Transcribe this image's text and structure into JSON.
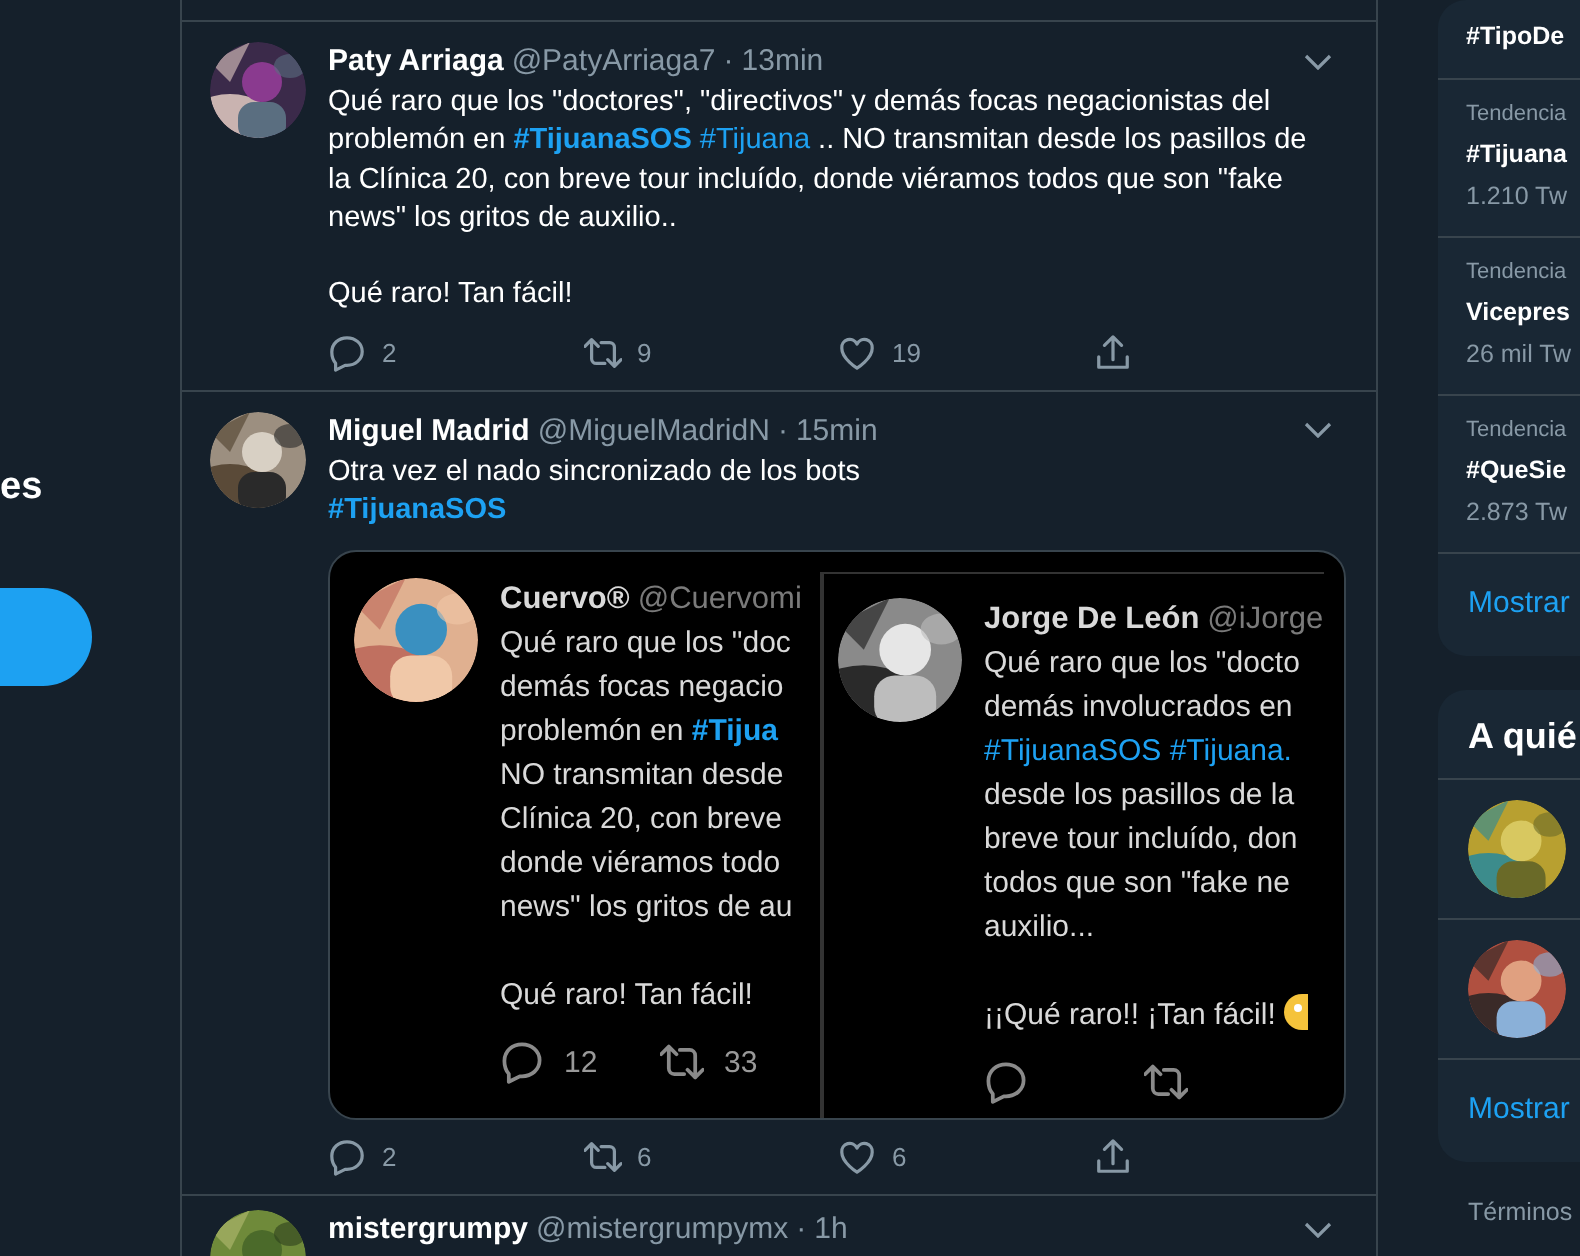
{
  "left_nav": {
    "item_text": "es"
  },
  "tweets": [
    {
      "name": "Paty Arriaga",
      "handle": "@PatyArriaga7",
      "separator": "·",
      "time": "13min",
      "avatar": {
        "kind": "picture"
      },
      "body": [
        {
          "kind": "text",
          "text": "Qué raro que los \"doctores\", \"directivos\" y demás focas negacionistas del problemón en "
        },
        {
          "kind": "hashtag",
          "bold": true,
          "text": "#TijuanaSOS "
        },
        {
          "kind": "hashtag",
          "bold": false,
          "text": "#Tijuana"
        },
        {
          "kind": "text",
          "text": " .. NO transmitan desde los pasillos de la Clínica 20, con breve tour incluído, donde viéramos todos que son \"fake news\" los gritos de auxilio..\n\nQué raro! Tan fácil!"
        }
      ],
      "actions": [
        {
          "kind": "reply",
          "count": "2"
        },
        {
          "kind": "retweet",
          "count": "9"
        },
        {
          "kind": "like",
          "count": "19"
        },
        {
          "kind": "share"
        }
      ]
    },
    {
      "name": "Miguel Madrid",
      "handle": "@MiguelMadridN",
      "separator": "·",
      "time": "15min",
      "avatar": {
        "kind": "picture"
      },
      "body": [
        {
          "kind": "text",
          "text": "Otra vez el nado sincronizado de los bots\n"
        },
        {
          "kind": "hashtag",
          "bold": true,
          "text": "#TijuanaSOS"
        }
      ],
      "media": {
        "panels": [
          {
            "name": "Cuervo®",
            "handle": "@Cuervomi",
            "avatar": {
              "kind": "picture"
            },
            "body": [
              {
                "kind": "text",
                "text": "Qué raro que los \"doc\ndemás focas negacio\nproblemón en "
              },
              {
                "kind": "hashtag",
                "bold": true,
                "text": "#Tijua"
              },
              {
                "kind": "text",
                "text": "\nNO transmitan desde\nClínica 20, con breve\ndonde viéramos todo\nnews\" los gritos de au\n\nQué raro! Tan fácil!"
              }
            ],
            "emoji": false,
            "actions": [
              {
                "kind": "reply",
                "count": "12"
              },
              {
                "kind": "retweet",
                "count": "33"
              }
            ]
          },
          {
            "name": "Jorge De León",
            "handle": "@iJorge",
            "avatar": {
              "kind": "picture"
            },
            "body": [
              {
                "kind": "text",
                "text": "Qué raro que los \"docto\ndemás involucrados en\n"
              },
              {
                "kind": "hashtag",
                "bold": false,
                "text": "#TijuanaSOS "
              },
              {
                "kind": "hashtag",
                "bold": false,
                "text": "#Tijuana."
              },
              {
                "kind": "text",
                "text": "\ndesde los pasillos de la\nbreve tour incluído, don\ntodos que son \"fake ne\nauxilio...\n\n¡¡Qué raro!! ¡Tan fácil!"
              }
            ],
            "emoji": true,
            "actions": [
              {
                "kind": "reply"
              },
              {
                "kind": "retweet"
              }
            ]
          }
        ]
      },
      "actions": [
        {
          "kind": "reply",
          "count": "2"
        },
        {
          "kind": "retweet",
          "count": "6"
        },
        {
          "kind": "like",
          "count": "6"
        },
        {
          "kind": "share"
        }
      ]
    },
    {
      "name": "mistergrumpy",
      "handle": "@mistergrumpymx",
      "separator": "·",
      "time": "1h",
      "avatar": {
        "kind": "picture"
      }
    }
  ],
  "trends_card": {
    "items": [
      {
        "title": "#TipoDe"
      },
      {
        "label": "Tendencia",
        "title": "#Tijuana",
        "count": "1.210 Tw"
      },
      {
        "label": "Tendencia",
        "title": "Vicepres",
        "count": "26 mil Tw"
      },
      {
        "label": "Tendencia",
        "title": "#QueSie",
        "count": "2.873 Tw"
      }
    ],
    "show_more": "Mostrar"
  },
  "follow_card": {
    "title": "A quié",
    "accounts": [
      {
        "kind": "picture"
      },
      {
        "kind": "picture"
      }
    ],
    "show_more": "Mostrar"
  },
  "footer_link": "Términos"
}
